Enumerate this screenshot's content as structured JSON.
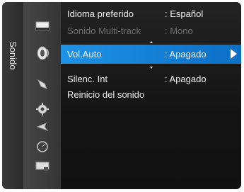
{
  "side": {
    "label": "Sonido"
  },
  "menu": {
    "items": [
      {
        "label": "Idioma preferido",
        "value": ": Español"
      },
      {
        "label": "Sonido Multi-track",
        "value": ": Mono"
      },
      {
        "label": "Vol.Auto",
        "value": ": Apagado"
      },
      {
        "label": "Silenc. Int",
        "value": ": Apagado"
      },
      {
        "label": "Reinicio del sonido",
        "value": ""
      }
    ]
  },
  "colors": {
    "selection": "#1f93e6",
    "disabled": "#6e6e6e"
  },
  "icons": [
    "picture-icon",
    "sound-icon",
    "channel-icon",
    "setup-icon",
    "input-icon",
    "application-icon",
    "support-icon"
  ]
}
